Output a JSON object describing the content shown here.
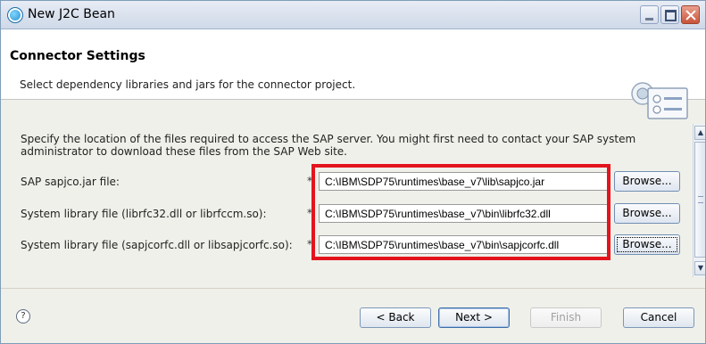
{
  "window": {
    "title": "New J2C Bean"
  },
  "banner": {
    "title": "Connector Settings",
    "description": "Select dependency libraries and jars for the connector project."
  },
  "intro": "Specify the location of the files required to access the SAP server. You might first need to contact your SAP system administrator to download these files from the SAP Web site.",
  "fields": [
    {
      "label": "SAP sapjco.jar file:",
      "required_marker": "*",
      "value": "C:\\IBM\\SDP75\\runtimes\\base_v7\\lib\\sapjco.jar",
      "browse_label": "Browse..."
    },
    {
      "label": "System library file (librfc32.dll or librfccm.so):",
      "required_marker": "*",
      "value": "C:\\IBM\\SDP75\\runtimes\\base_v7\\bin\\librfc32.dll",
      "browse_label": "Browse..."
    },
    {
      "label": "System library file (sapjcorfc.dll or libsapjcorfc.so):",
      "required_marker": "*",
      "value": "C:\\IBM\\SDP75\\runtimes\\base_v7\\bin\\sapjcorfc.dll",
      "browse_label": "Browse..."
    }
  ],
  "buttons": {
    "help": "?",
    "back": "< Back",
    "next": "Next >",
    "finish": "Finish",
    "cancel": "Cancel"
  },
  "colors": {
    "highlight": "#e3141d",
    "accent": "#1a7fc7"
  }
}
